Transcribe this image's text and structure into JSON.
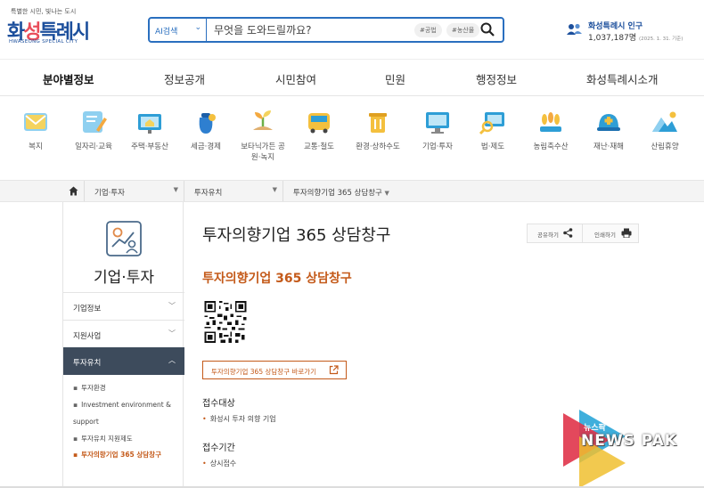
{
  "header": {
    "logo_tagline": "특별한 시민, 빛나는 도시",
    "logo_name_left": "화",
    "logo_name_o": "성",
    "logo_name_right": "특례시",
    "logo_english": "HWASEONG SPECIAL CITY",
    "search_select": "AI검색",
    "search_placeholder": "무엇을 도와드릴까요?",
    "chip1": "#공법",
    "chip2": "#농산물",
    "population_label": "화성특례시 인구",
    "population_value": "1,037,187명",
    "population_date": "(2025. 1. 31. 기준)"
  },
  "gnb": [
    "분야별정보",
    "정보공개",
    "시민참여",
    "민원",
    "행정정보",
    "화성특례시소개"
  ],
  "categories": [
    {
      "label": "복지",
      "icon": "mail-icon"
    },
    {
      "label": "일자리·교육",
      "icon": "pencil-note-icon"
    },
    {
      "label": "주택·부동산",
      "icon": "house-board-icon"
    },
    {
      "label": "세금·경제",
      "icon": "money-bag-icon"
    },
    {
      "label": "보타닉가든 공원·녹지",
      "icon": "sprout-icon"
    },
    {
      "label": "교통·철도",
      "icon": "bus-icon"
    },
    {
      "label": "환경·상하수도",
      "icon": "trash-bin-icon"
    },
    {
      "label": "기업·투자",
      "icon": "monitor-icon"
    },
    {
      "label": "법·제도",
      "icon": "magnifier-doc-icon"
    },
    {
      "label": "농림축수산",
      "icon": "wheat-icon"
    },
    {
      "label": "재난·재해",
      "icon": "helmet-icon"
    },
    {
      "label": "산림휴양",
      "icon": "mountain-icon"
    }
  ],
  "breadcrumb": {
    "s1": "기업·투자",
    "s2": "투자유치",
    "s3": "투자의향기업 365 상담창구"
  },
  "lnb": {
    "title": "기업·투자",
    "menus": [
      "기업정보",
      "지원사업",
      "투자유치"
    ],
    "subs": [
      "투자환경",
      "Investment environment &",
      "support",
      "투자유치 지원제도",
      "투자의향기업 365 상담창구"
    ]
  },
  "content": {
    "title": "투자의향기업 365 상담창구",
    "share": "공유하기",
    "print": "인쇄하기",
    "subtitle": "투자의향기업 365 상담창구",
    "link": "투자의향기업 365 상담창구 바로가기",
    "h_target": "접수대상",
    "target_item": "화성시 투자 의향 기업",
    "h_period": "접수기간",
    "period_item": "상시접수"
  },
  "watermark": {
    "korean": "뉴스팍",
    "name": "NEWS PAK"
  },
  "colors": {
    "brand": "#1c4f9c",
    "accent": "#c45a1a",
    "lnb_active": "#3d4b5c"
  }
}
